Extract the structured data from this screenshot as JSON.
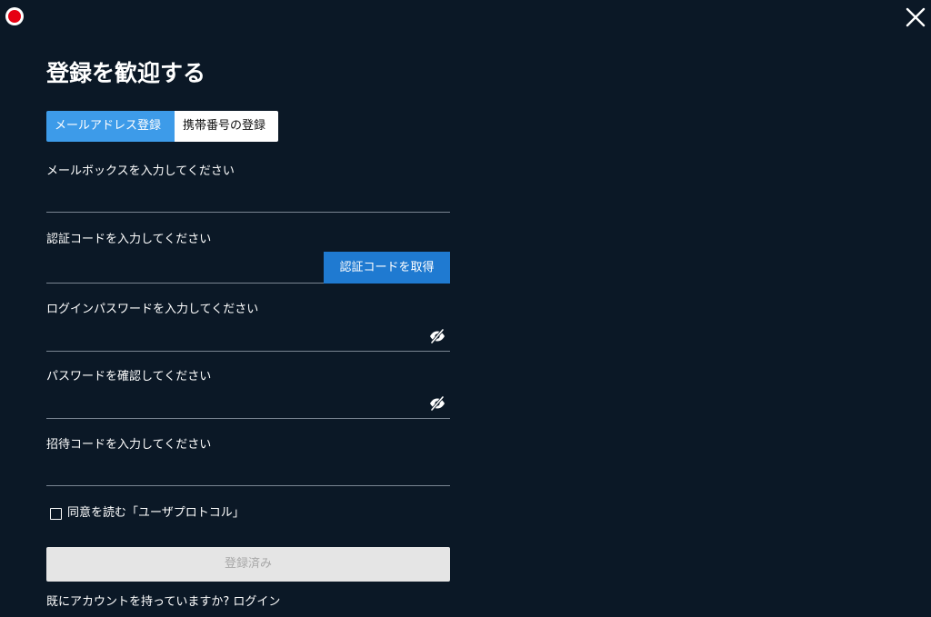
{
  "title": "登録を歓迎する",
  "tabs": {
    "email": "メールアドレス登録",
    "phone": "携帯番号の登録"
  },
  "fields": {
    "email": {
      "label": "メールボックスを入力してください",
      "value": ""
    },
    "code": {
      "label": "認証コードを入力してください",
      "value": "",
      "button": "認証コードを取得"
    },
    "password": {
      "label": "ログインパスワードを入力してください",
      "value": ""
    },
    "confirm": {
      "label": "パスワードを確認してください",
      "value": ""
    },
    "invite": {
      "label": "招待コードを入力してください",
      "value": ""
    }
  },
  "agreement": {
    "text": "同意を読む",
    "link": "「ユーザプロトコル」",
    "checked": false
  },
  "submit_label": "登録済み",
  "login": {
    "prompt": "既にアカウントを持っていますか?",
    "link": "ログイン"
  },
  "icons": {
    "record": "record-dot-icon",
    "close": "close-icon",
    "password_toggle": "eye-off-icon"
  },
  "colors": {
    "background": "#0b1826",
    "active_tab": "#3d9be9",
    "code_button": "#1f7ad1",
    "record": "#e60012"
  }
}
